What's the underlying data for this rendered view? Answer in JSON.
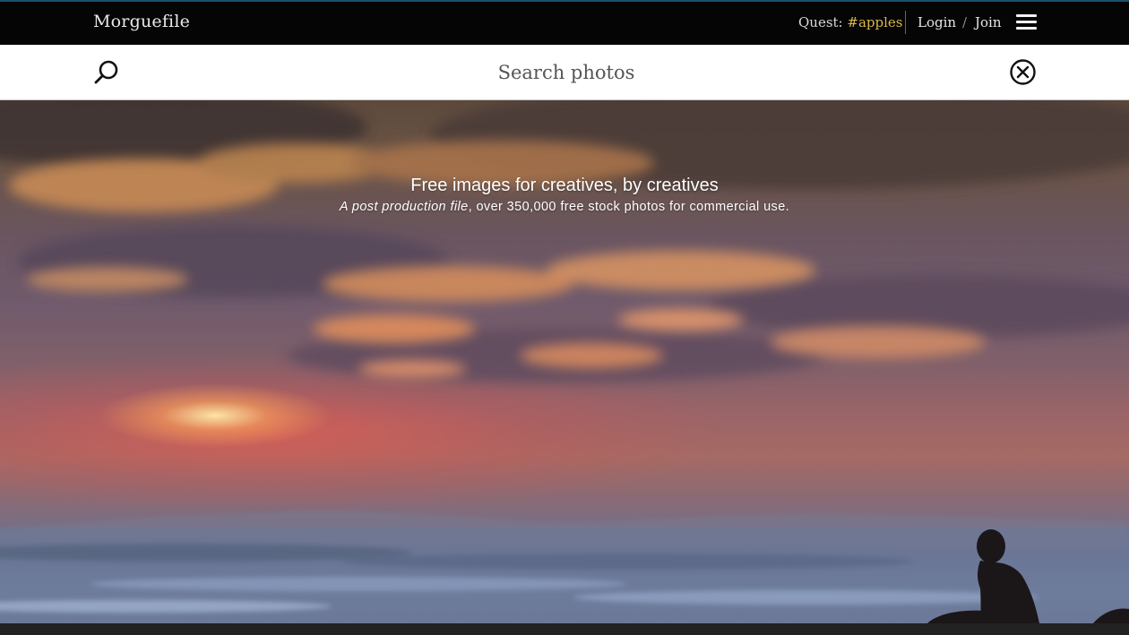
{
  "header": {
    "logo": "Morguefile",
    "quest_label": "Quest: ",
    "quest_tag": "#apples",
    "login": "Login",
    "separator": "/",
    "join": "Join",
    "menu_icon": "hamburger-menu-icon"
  },
  "search": {
    "placeholder": "Search photos",
    "value": "",
    "search_icon": "search-icon",
    "close_icon": "close-circle-icon"
  },
  "hero": {
    "title": "Free images for creatives, by creatives",
    "subtitle_italic": "A post production file",
    "subtitle_rest": ", over 350,000 free stock photos for commercial use."
  },
  "colors": {
    "topbar_bg": "#050505",
    "quest_tag": "#d7b84a",
    "searchbar_bg": "#ffffff"
  }
}
